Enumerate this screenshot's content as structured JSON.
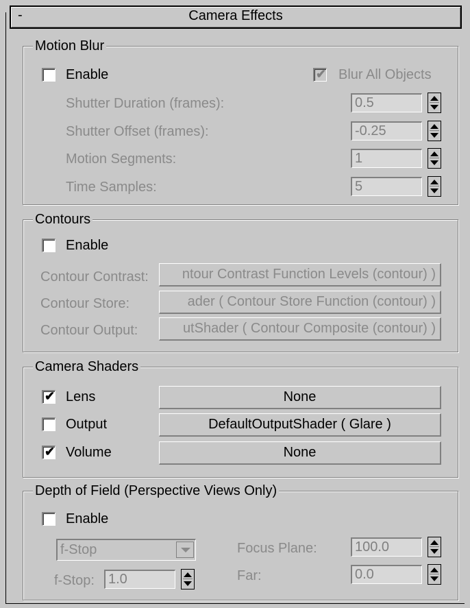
{
  "rollout": {
    "collapse_glyph": "-",
    "title": "Camera Effects"
  },
  "motion_blur": {
    "group_title": "Motion Blur",
    "enable_label": "Enable",
    "enable_checked": false,
    "blur_all_label": "Blur All Objects",
    "blur_all_checked": true,
    "fields": [
      {
        "label": "Shutter Duration (frames):",
        "value": "0.5"
      },
      {
        "label": "Shutter Offset (frames):",
        "value": "-0.25"
      },
      {
        "label": "Motion Segments:",
        "value": "1"
      },
      {
        "label": "Time Samples:",
        "value": "5"
      }
    ]
  },
  "contours": {
    "group_title": "Contours",
    "enable_label": "Enable",
    "enable_checked": false,
    "rows": [
      {
        "label": "Contour Contrast:",
        "button": "ntour Contrast Function Levels (contour) )"
      },
      {
        "label": "Contour Store:",
        "button": "ader  ( Contour Store Function (contour) )"
      },
      {
        "label": "Contour Output:",
        "button": "utShader  ( Contour Composite (contour) )"
      }
    ]
  },
  "camera_shaders": {
    "group_title": "Camera Shaders",
    "rows": [
      {
        "label": "Lens",
        "checked": true,
        "button": "None"
      },
      {
        "label": "Output",
        "checked": false,
        "button": "DefaultOutputShader  ( Glare )"
      },
      {
        "label": "Volume",
        "checked": true,
        "button": "None"
      }
    ]
  },
  "depth_of_field": {
    "group_title": "Depth of Field (Perspective Views Only)",
    "enable_label": "Enable",
    "enable_checked": false,
    "mode_select": "f-Stop",
    "fstop_label": "f-Stop:",
    "fstop_value": "1.0",
    "focus_plane_label": "Focus Plane:",
    "focus_plane_value": "100.0",
    "far_label": "Far:",
    "far_value": "0.0"
  },
  "glyphs": {
    "check": "✔"
  },
  "icons": {
    "spinner": "spinner-arrows-icon",
    "dropdown": "dropdown-arrow-icon",
    "checkmark": "checkmark-icon"
  }
}
